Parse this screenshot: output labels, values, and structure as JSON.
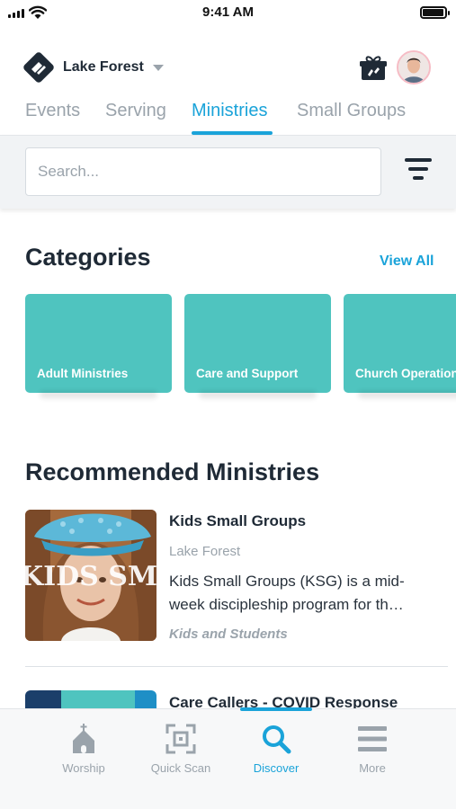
{
  "status_bar": {
    "time": "9:41 AM"
  },
  "header": {
    "campus_name": "Lake Forest"
  },
  "tabs": [
    {
      "label": "Events",
      "active": false
    },
    {
      "label": "Serving",
      "active": false
    },
    {
      "label": "Ministries",
      "active": true
    },
    {
      "label": "Small Groups",
      "active": false
    }
  ],
  "search": {
    "placeholder": "Search...",
    "value": ""
  },
  "categories": {
    "title": "Categories",
    "view_all": "View All",
    "items": [
      {
        "label": "Adult Ministries"
      },
      {
        "label": "Care and Support"
      },
      {
        "label": "Church Operations"
      }
    ]
  },
  "recommended": {
    "title": "Recommended Ministries",
    "items": [
      {
        "title": "Kids Small Groups",
        "campus": "Lake Forest",
        "description": "Kids Small Groups (KSG) is a mid-week discipleship program for th…",
        "category": "Kids and Students",
        "thumb_text": "KIDS SMAL"
      },
      {
        "title": "Care Callers - COVID Response"
      }
    ]
  },
  "bottom_nav": {
    "items": [
      {
        "label": "Worship",
        "icon": "church-icon",
        "active": false
      },
      {
        "label": "Quick Scan",
        "icon": "qr-scan-icon",
        "active": false
      },
      {
        "label": "Discover",
        "icon": "search-icon",
        "active": true
      },
      {
        "label": "More",
        "icon": "menu-icon",
        "active": false
      }
    ]
  },
  "colors": {
    "accent": "#1aa3d9",
    "category_card": "#4fc4bf",
    "text_primary": "#1f2a36",
    "text_muted": "#9aa3ab"
  }
}
